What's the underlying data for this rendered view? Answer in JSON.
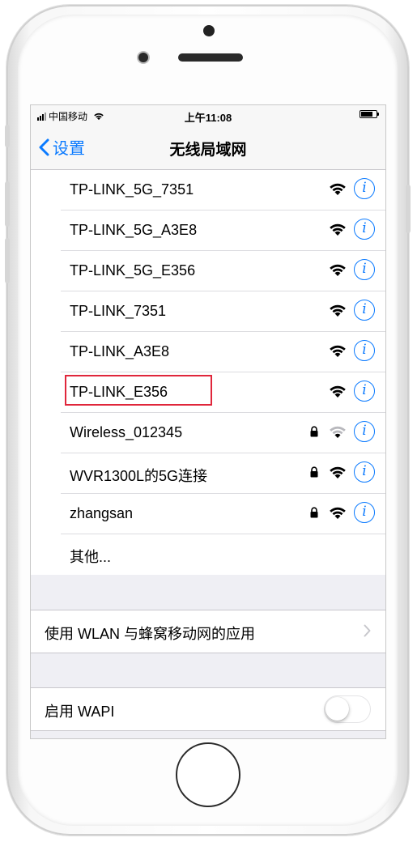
{
  "statusbar": {
    "carrier": "中国移动",
    "time": "上午11:08"
  },
  "nav": {
    "back_label": "设置",
    "title": "无线局域网"
  },
  "networks": [
    {
      "name": "TP-LINK_5G_7351",
      "locked": false,
      "signal": "full"
    },
    {
      "name": "TP-LINK_5G_A3E8",
      "locked": false,
      "signal": "full"
    },
    {
      "name": "TP-LINK_5G_E356",
      "locked": false,
      "signal": "full"
    },
    {
      "name": "TP-LINK_7351",
      "locked": false,
      "signal": "full"
    },
    {
      "name": "TP-LINK_A3E8",
      "locked": false,
      "signal": "full"
    },
    {
      "name": "TP-LINK_E356",
      "locked": false,
      "signal": "full",
      "highlighted": true
    },
    {
      "name": "Wireless_012345",
      "locked": true,
      "signal": "weak"
    },
    {
      "name": "WVR1300L的5G连接",
      "locked": true,
      "signal": "full"
    },
    {
      "name": "zhangsan",
      "locked": true,
      "signal": "full"
    }
  ],
  "other_label": "其他...",
  "wlan_apps_label": "使用 WLAN 与蜂窝移动网的应用",
  "wapi_label": "启用 WAPI",
  "wapi_enabled": false,
  "colors": {
    "accent": "#0a7aff",
    "highlight": "#e0263b"
  }
}
